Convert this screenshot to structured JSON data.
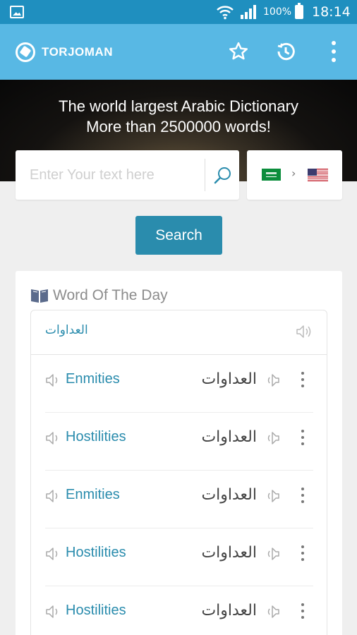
{
  "status_bar": {
    "battery": "100%",
    "time": "18:14"
  },
  "app_bar": {
    "title": "TORJOMAN",
    "icons": [
      "star-icon",
      "history-icon",
      "more-vert-icon"
    ]
  },
  "banner": {
    "line1": "The world largest Arabic Dictionary",
    "line2": "More than 2500000 words!"
  },
  "search": {
    "placeholder": "Enter Your text here",
    "button_label": "Search",
    "source_language": "Arabic",
    "target_language": "English"
  },
  "word_of_the_day": {
    "title": "Word Of The Day",
    "word": "العداوات",
    "translations": [
      {
        "english": "Enmities",
        "arabic": "العداوات"
      },
      {
        "english": "Hostilities",
        "arabic": "العداوات"
      },
      {
        "english": "Enmities",
        "arabic": "العداوات"
      },
      {
        "english": "Hostilities",
        "arabic": "العداوات"
      },
      {
        "english": "Hostilities",
        "arabic": "العداوات"
      }
    ]
  },
  "colors": {
    "status_bar": "#1f8fbf",
    "app_bar": "#58b8e4",
    "accent": "#2a8cad",
    "background": "#efefef"
  }
}
